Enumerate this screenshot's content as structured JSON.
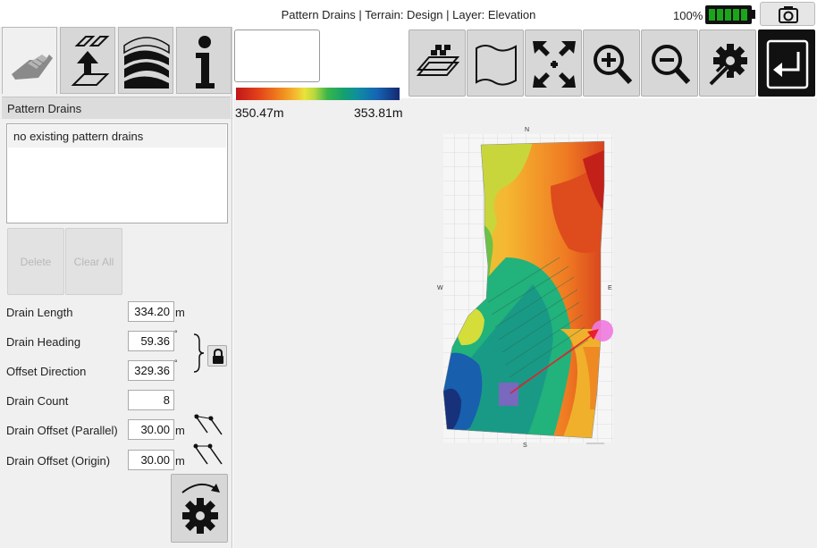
{
  "titlebar": {
    "title": "Pattern Drains | Terrain: Design | Layer: Elevation",
    "battery_percent": "100%"
  },
  "left_tabs": [
    {
      "name": "pattern-drains-tab",
      "icon": "field-drain-icon",
      "active": true
    },
    {
      "name": "upload-tab",
      "icon": "layer-upload-icon",
      "active": false
    },
    {
      "name": "terrain-tab",
      "icon": "terrain-layers-icon",
      "active": false
    },
    {
      "name": "info-tab",
      "icon": "info-icon",
      "active": false
    }
  ],
  "panel": {
    "header": "Pattern Drains",
    "list_items": [
      "no existing pattern drains"
    ],
    "delete_label": "Delete",
    "clear_all_label": "Clear All"
  },
  "fields": {
    "drain_length": {
      "label": "Drain Length",
      "value": "334.20",
      "unit": "m"
    },
    "drain_heading": {
      "label": "Drain Heading",
      "value": "59.36",
      "unit": "°"
    },
    "offset_direction": {
      "label": "Offset Direction",
      "value": "329.36",
      "unit": "°"
    },
    "drain_count": {
      "label": "Drain Count",
      "value": "8"
    },
    "drain_offset_parallel": {
      "label": "Drain Offset (Parallel)",
      "value": "30.00",
      "unit": "m"
    },
    "drain_offset_origin": {
      "label": "Drain Offset (Origin)",
      "value": "30.00",
      "unit": "m"
    }
  },
  "toolbar": [
    "grid-layer-icon",
    "map-icon",
    "zoom-extents-icon",
    "zoom-in-icon",
    "zoom-out-icon",
    "settings-wrench-icon",
    "exit-icon"
  ],
  "legend": {
    "min_label": "350.47m",
    "max_label": "353.81m"
  },
  "map": {
    "compass_n": "N",
    "compass_s": "S",
    "compass_e": "E",
    "compass_w": "W"
  },
  "colors": {
    "accent_red": "#e8202a",
    "marker_pink": "#f07adf",
    "marker_purple": "#8a5fc8",
    "battery_green": "#1aa51a"
  }
}
